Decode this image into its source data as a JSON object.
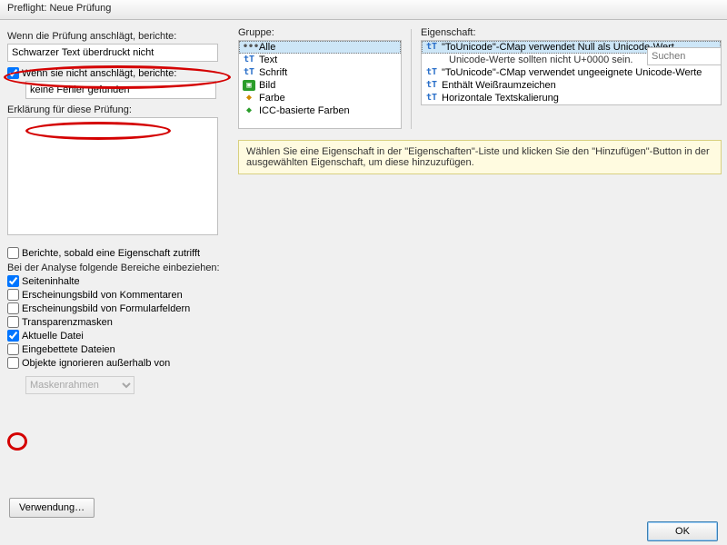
{
  "window": {
    "title": "Preflight: Neue Prüfung"
  },
  "left": {
    "label_hit": "Wenn die Prüfung anschlägt, berichte:",
    "hit_text": "Schwarzer Text überdruckt nicht",
    "chk_nohit_label": "Wenn sie nicht anschlägt, berichte:",
    "nohit_text": "keine Fehler gefunden",
    "explain_label": "Erklärung für diese Prüfung:",
    "chk_anyprop": "Berichte, sobald eine Eigenschaft zutrifft",
    "areas_label": "Bei der Analyse folgende Bereiche einbeziehen:",
    "cb": {
      "pagecontent": "Seiteninhalte",
      "annots": "Erscheinungsbild von Kommentaren",
      "formfields": "Erscheinungsbild von Formularfeldern",
      "transp": "Transparenzmasken",
      "curfile": "Aktuelle Datei",
      "embedded": "Eingebettete Dateien",
      "ignoreobj": "Objekte ignorieren außerhalb von"
    },
    "mask_select": "Maskenrahmen",
    "usage_btn": "Verwendung…"
  },
  "right": {
    "group_label": "Gruppe:",
    "prop_label": "Eigenschaft:",
    "search_ph": "Suchen",
    "groups": [
      "Alle",
      "Text",
      "Schrift",
      "Bild",
      "Farbe",
      "ICC-basierte Farben"
    ],
    "props": [
      "\"ToUnicode\"-CMap verwendet Null als Unicode-Wert",
      "Unicode-Werte sollten nicht U+0000 sein.",
      "\"ToUnicode\"-CMap verwendet ungeeignete Unicode-Werte",
      "Enthält Weißraumzeichen",
      "Horizontale Textskalierung"
    ],
    "hint": "Wählen Sie eine Eigenschaft in der \"Eigenschaften\"-Liste und klicken Sie den \"Hinzufügen\"-Button in der ausgewählten Eigenschaft, um diese hinzuzufügen."
  },
  "footer": {
    "ok": "OK"
  }
}
